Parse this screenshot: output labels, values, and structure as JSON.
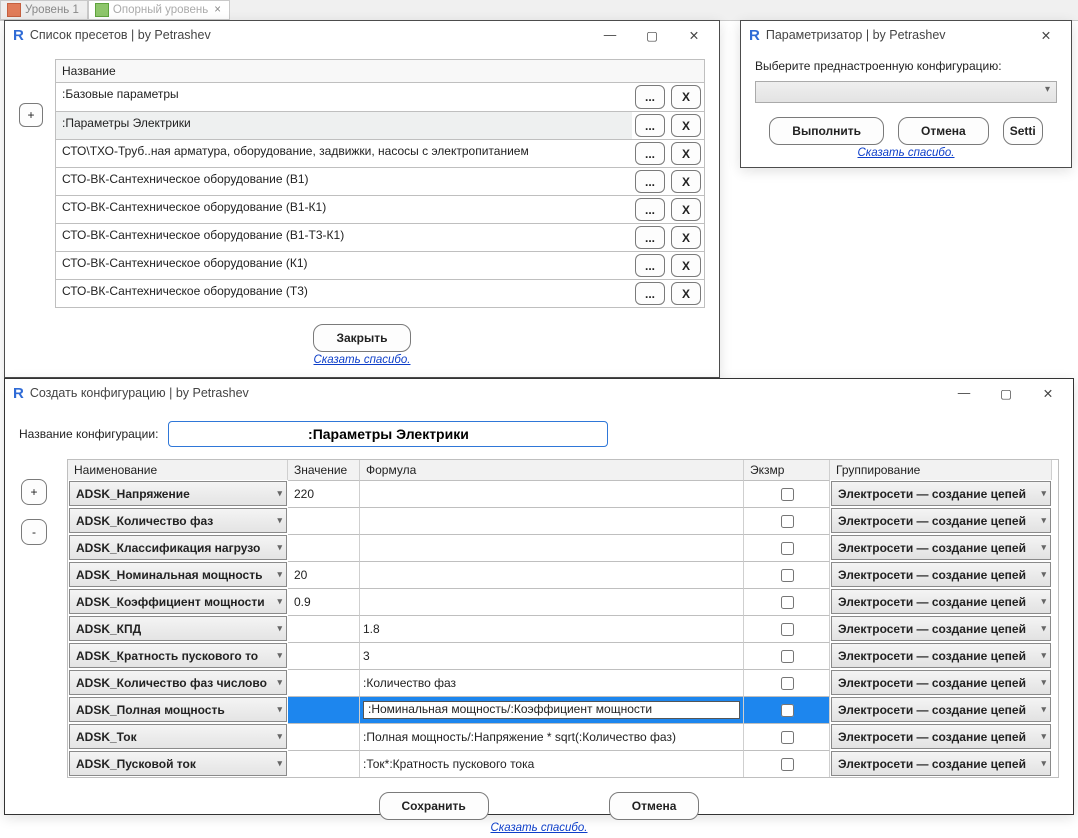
{
  "tabs": [
    {
      "label": "Уровень 1"
    },
    {
      "label": "Опорный уровень"
    }
  ],
  "presets_window": {
    "title": "Список пресетов | by Petrashev",
    "header": "Название",
    "add": "+",
    "rows": [
      {
        "name": ":Базовые параметры",
        "sel": false
      },
      {
        "name": ":Параметры Электрики",
        "sel": true
      },
      {
        "name": "СТО\\ТХО-Труб..ная арматура, оборудование, задвижки, насосы с электропитанием",
        "sel": false
      },
      {
        "name": "СТО-ВК-Сантехническое оборудование (В1)",
        "sel": false
      },
      {
        "name": "СТО-ВК-Сантехническое оборудование (В1-К1)",
        "sel": false
      },
      {
        "name": "СТО-ВК-Сантехническое оборудование (В1-Т3-К1)",
        "sel": false
      },
      {
        "name": "СТО-ВК-Сантехническое оборудование (К1)",
        "sel": false
      },
      {
        "name": "СТО-ВК-Сантехническое оборудование (Т3)",
        "sel": false
      }
    ],
    "row_edit": "...",
    "row_delete": "X",
    "close": "Закрыть",
    "thanks": "Сказать спасибо."
  },
  "param_window": {
    "title": "Параметризатор | by Petrashev",
    "prompt": "Выберите преднастроенную конфигурацию:",
    "run": "Выполнить",
    "cancel": "Отмена",
    "settings": "Setti",
    "thanks": "Сказать спасибо."
  },
  "config_window": {
    "title": "Создать конфигурацию | by Petrashev",
    "name_label": "Название конфигурации:",
    "name_value": ":Параметры Электрики",
    "add": "+",
    "remove": "-",
    "columns": {
      "name": "Наименование",
      "value": "Значение",
      "formula": "Формула",
      "ex": "Экзмр",
      "group": "Группирование"
    },
    "group_default": "Электросети — создание цепей",
    "rows": [
      {
        "name": "ADSK_Напряжение",
        "value": "220",
        "formula": "",
        "sel": false
      },
      {
        "name": "ADSK_Количество фаз",
        "value": "",
        "formula": "",
        "sel": false
      },
      {
        "name": "ADSK_Классификация нагрузо",
        "value": "",
        "formula": "",
        "sel": false
      },
      {
        "name": "ADSK_Номинальная мощность",
        "value": "20",
        "formula": "",
        "sel": false
      },
      {
        "name": "ADSK_Коэффициент мощности",
        "value": "0.9",
        "formula": "",
        "sel": false
      },
      {
        "name": "ADSK_КПД",
        "value": "",
        "formula": "1.8",
        "sel": false
      },
      {
        "name": "ADSK_Кратность пускового то",
        "value": "",
        "formula": "3",
        "sel": false
      },
      {
        "name": "ADSK_Количество фаз числово",
        "value": "",
        "formula": ":Количество фаз",
        "sel": false
      },
      {
        "name": "ADSK_Полная мощность",
        "value": "",
        "formula": ":Номинальная мощность/:Коэффициент мощности",
        "sel": true
      },
      {
        "name": "ADSK_Ток",
        "value": "",
        "formula": ":Полная мощность/:Напряжение * sqrt(:Количество фаз)",
        "sel": false
      },
      {
        "name": "ADSK_Пусковой ток",
        "value": "",
        "formula": ":Ток*:Кратность пускового тока",
        "sel": false
      }
    ],
    "save": "Сохранить",
    "cancel": "Отмена",
    "thanks": "Сказать спасибо."
  }
}
